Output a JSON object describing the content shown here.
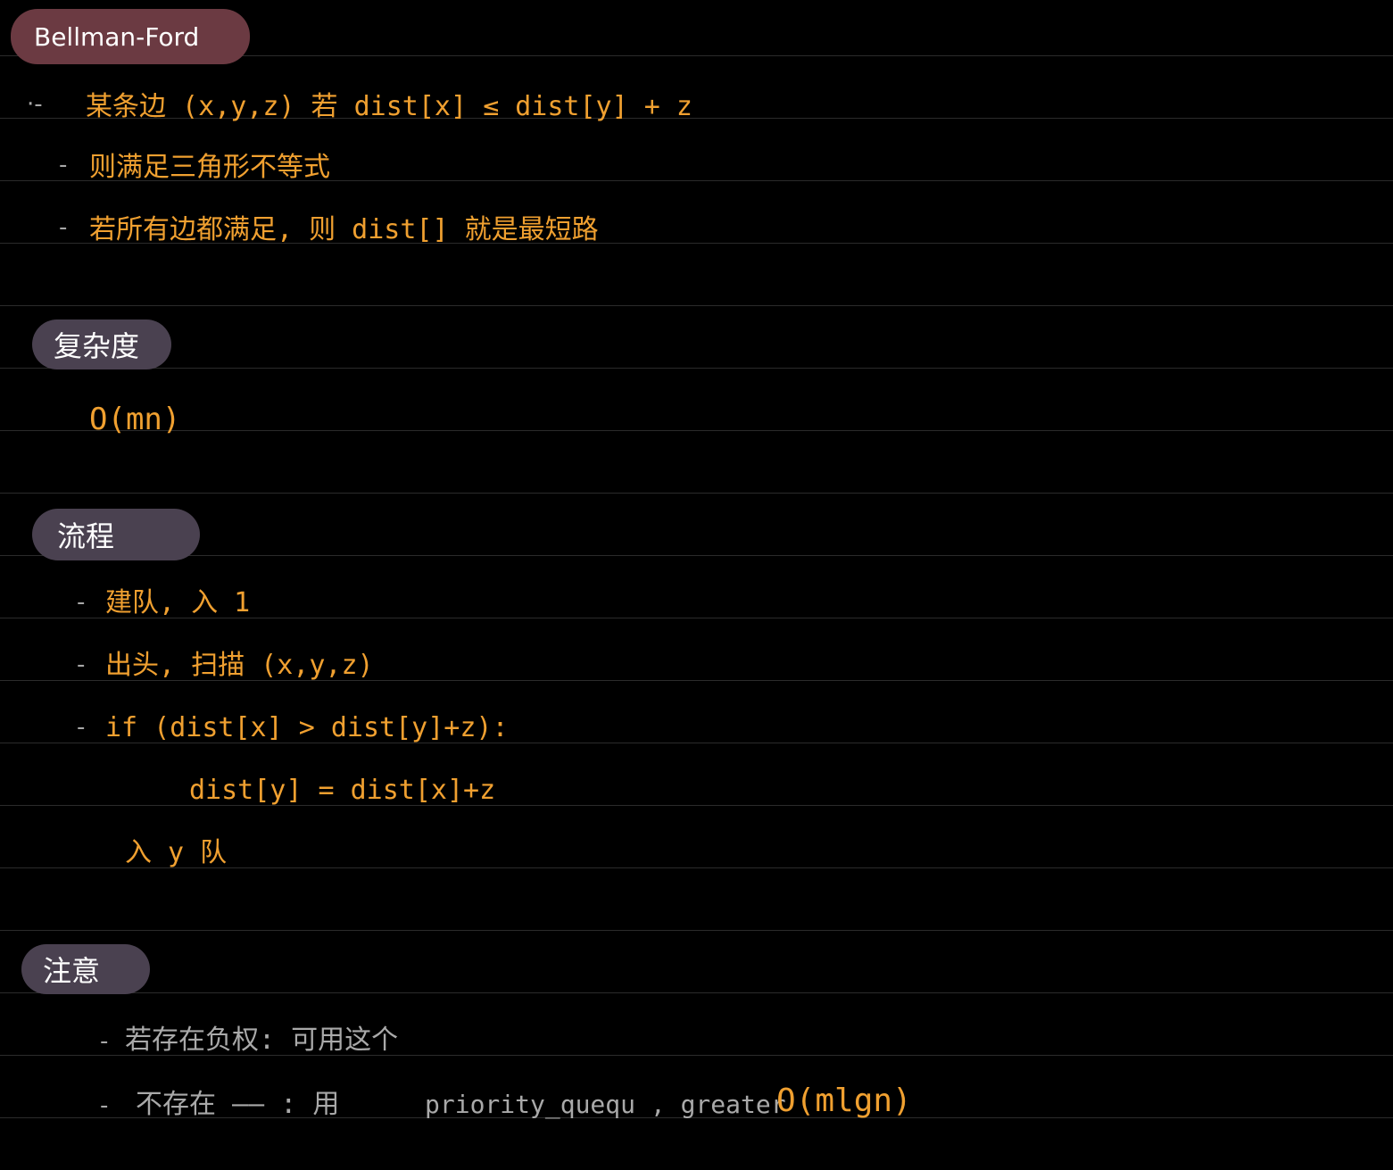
{
  "headings": {
    "title": "Bellman-Ford",
    "complexity": "复杂度",
    "process": "流程",
    "notes": "注意"
  },
  "intro": {
    "line1_bullet": "·-",
    "line1": "某条边 (x,y,z) 若 dist[x] ≤ dist[y] + z",
    "line2_bullet": "-",
    "line2": "则满足三角形不等式",
    "line3_bullet": "-",
    "line3": "若所有边都满足, 则 dist[] 就是最短路"
  },
  "complexity": {
    "value": "O(mn)"
  },
  "process": {
    "step1_bullet": "-",
    "step1": "建队, 入 1",
    "step2_bullet": "-",
    "step2": "出头, 扫描 (x,y,z)",
    "step3_bullet": "-",
    "step3": "if (dist[x] > dist[y]+z):",
    "step3_body": "dist[y] = dist[x]+z",
    "step3_tail": "入 y 队"
  },
  "notes": {
    "note1_bullet": "-",
    "note1": "若存在负权: 可用这个",
    "note2_bullet": "-",
    "note2_prefix": "不存在 —— : 用",
    "note2_code": "priority_quequ , greater",
    "note2_complexity": "O(mlgn)"
  },
  "colors": {
    "background": "#000000",
    "ink_orange": "#f0a030",
    "ink_grey": "#a9a9a9",
    "title_tag": "#6b3a42",
    "section_tag": "#4a4150"
  }
}
